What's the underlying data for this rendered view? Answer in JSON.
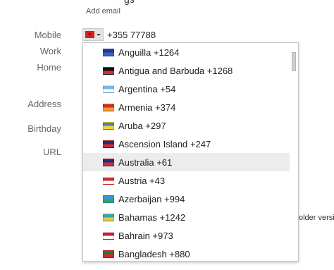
{
  "header": {
    "clipped_text": "gs",
    "add_email": "Add email"
  },
  "fields": {
    "mobile": "Mobile",
    "work": "Work",
    "home": "Home",
    "address": "Address",
    "birthday": "Birthday",
    "url": "URL"
  },
  "phone": {
    "selected_country_icon": "albania-flag-icon",
    "selected_flag_glyph": "✶",
    "value": "+355 77788"
  },
  "country_dropdown": {
    "highlighted_index": 6,
    "items": [
      {
        "label": "Anguilla +1264",
        "icon": "anguilla-flag-icon",
        "flag_colors": [
          "#1f3a8f",
          "#3d5fb8"
        ]
      },
      {
        "label": "Antigua and Barbuda +1268",
        "icon": "antigua-and-barbuda-flag-icon",
        "flag_colors": [
          "#111111",
          "#d62a2a"
        ]
      },
      {
        "label": "Argentina +54",
        "icon": "argentina-flag-icon",
        "flag_colors": [
          "#7ab8e6",
          "#ffffff"
        ]
      },
      {
        "label": "Armenia +374",
        "icon": "armenia-flag-icon",
        "flag_colors": [
          "#d22a2a",
          "#f0a030"
        ]
      },
      {
        "label": "Aruba +297",
        "icon": "aruba-flag-icon",
        "flag_colors": [
          "#3a86c8",
          "#f5d42a"
        ]
      },
      {
        "label": "Ascension Island +247",
        "icon": "ascension-island-flag-icon",
        "flag_colors": [
          "#1c2f7a",
          "#d02a35"
        ]
      },
      {
        "label": "Australia +61",
        "icon": "australia-flag-icon",
        "flag_colors": [
          "#1c2f7a",
          "#d02a35"
        ]
      },
      {
        "label": "Austria +43",
        "icon": "austria-flag-icon",
        "flag_colors": [
          "#d52b2b",
          "#ffffff"
        ]
      },
      {
        "label": "Azerbaijan +994",
        "icon": "azerbaijan-flag-icon",
        "flag_colors": [
          "#2f9bd6",
          "#3aa34a"
        ]
      },
      {
        "label": "Bahamas +1242",
        "icon": "bahamas-flag-icon",
        "flag_colors": [
          "#2aa7c4",
          "#f0c82a"
        ]
      },
      {
        "label": "Bahrain +973",
        "icon": "bahrain-flag-icon",
        "flag_colors": [
          "#d11d2a",
          "#ffffff"
        ]
      },
      {
        "label": "Bangladesh +880",
        "icon": "bangladesh-flag-icon",
        "flag_colors": [
          "#1a7a3a",
          "#d8242a"
        ]
      }
    ]
  },
  "right_link": "older versio"
}
